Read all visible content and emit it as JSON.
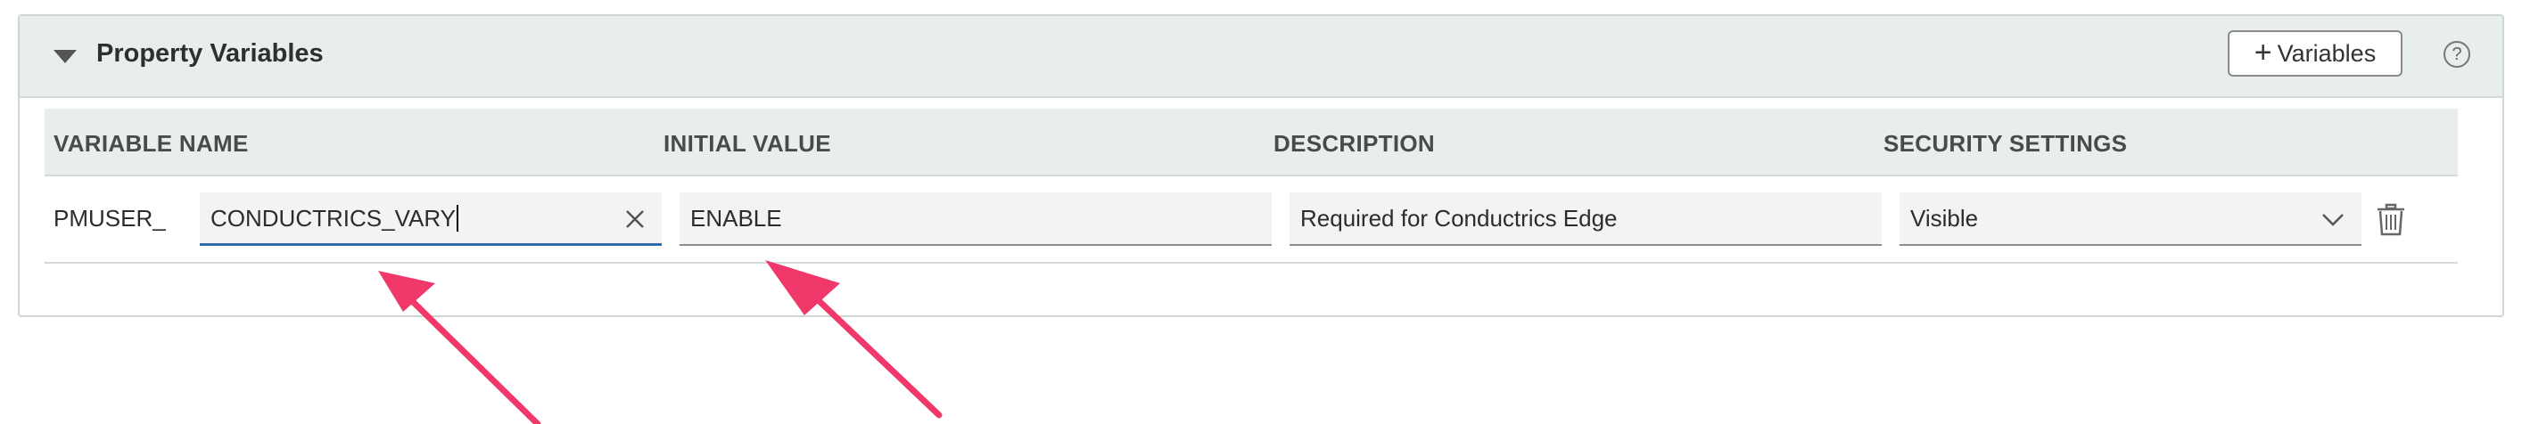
{
  "panel": {
    "title": "Property Variables",
    "add_button_label": "Variables",
    "add_button_icon": "plus-icon",
    "help_symbol": "?"
  },
  "table": {
    "columns": [
      "VARIABLE NAME",
      "INITIAL VALUE",
      "DESCRIPTION",
      "SECURITY SETTINGS"
    ],
    "rows": [
      {
        "name_prefix": "PMUSER_",
        "name_value": "CONDUCTRICS_VARY",
        "initial_value": "ENABLE",
        "description": "Required for Conductrics Edge",
        "security": "Visible"
      }
    ]
  },
  "colors": {
    "arrow": "#f0386b",
    "focus_underline": "#2f6ea6",
    "header_bg": "#e8eded"
  }
}
